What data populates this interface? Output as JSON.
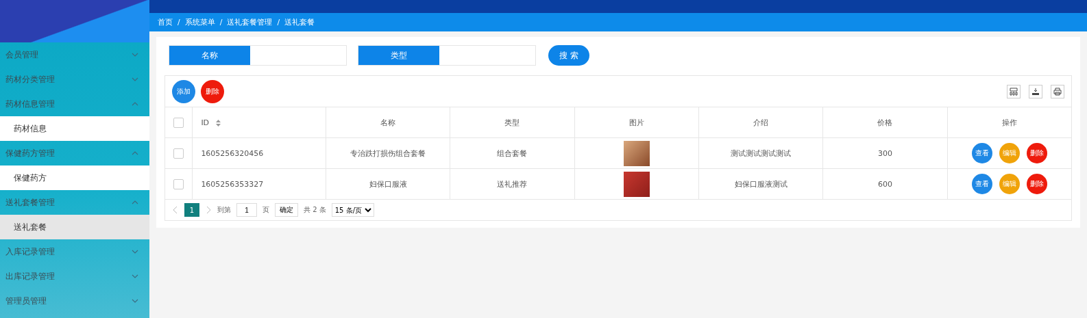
{
  "sidebar": {
    "items": [
      {
        "kind": "group",
        "label": "会员管理",
        "expanded": false
      },
      {
        "kind": "group",
        "label": "药材分类管理",
        "expanded": false
      },
      {
        "kind": "group",
        "label": "药材信息管理",
        "expanded": true
      },
      {
        "kind": "child",
        "label": "药材信息",
        "selected": false
      },
      {
        "kind": "group",
        "label": "保健药方管理",
        "expanded": true
      },
      {
        "kind": "child",
        "label": "保健药方",
        "selected": false
      },
      {
        "kind": "group",
        "label": "送礼套餐管理",
        "expanded": true
      },
      {
        "kind": "child",
        "label": "送礼套餐",
        "selected": true
      },
      {
        "kind": "group",
        "label": "入库记录管理",
        "expanded": false
      },
      {
        "kind": "group",
        "label": "出库记录管理",
        "expanded": false
      },
      {
        "kind": "group",
        "label": "管理员管理",
        "expanded": false
      }
    ]
  },
  "breadcrumb": [
    "首页",
    "系统菜单",
    "送礼套餐管理",
    "送礼套餐"
  ],
  "breadcrumb_separator": "/",
  "search": {
    "fields": [
      {
        "label": "名称"
      },
      {
        "label": "类型"
      }
    ],
    "button": "搜 索"
  },
  "toolbar": {
    "buttons": [
      {
        "label": "添加",
        "kind": "add"
      },
      {
        "label": "删除",
        "kind": "delete"
      }
    ]
  },
  "table": {
    "all_checked": false,
    "columns": [
      {
        "label": "ID",
        "sortable": true
      },
      {
        "label": "名称",
        "sortable": false
      },
      {
        "label": "类型",
        "sortable": false
      },
      {
        "label": "图片",
        "sortable": false
      },
      {
        "label": "介绍",
        "sortable": false
      },
      {
        "label": "价格",
        "sortable": false
      },
      {
        "label": "操作",
        "sortable": false
      }
    ],
    "rows": [
      {
        "checked": false,
        "id": "1605256320456",
        "name": "专治跌打损伤组合套餐",
        "type": "组合套餐",
        "intro": "测试测试测试测试",
        "price": "300",
        "actions": [
          {
            "label": "查看",
            "kind": "view"
          },
          {
            "label": "编辑",
            "kind": "edit"
          },
          {
            "label": "删除",
            "kind": "delete"
          }
        ]
      },
      {
        "checked": false,
        "id": "1605256353327",
        "name": "妇保口服液",
        "type": "送礼推荐",
        "intro": "妇保口服液测试",
        "price": "600",
        "actions": [
          {
            "label": "查看",
            "kind": "view"
          },
          {
            "label": "编辑",
            "kind": "edit"
          },
          {
            "label": "删除",
            "kind": "delete"
          }
        ]
      }
    ]
  },
  "pagination": {
    "pages": [
      {
        "label": "1",
        "selected": true
      }
    ],
    "goto_label": "到第",
    "page_input": "1",
    "page_unit": "页",
    "confirm": "确定",
    "total": "共 2 条",
    "page_size": "15 条/页"
  }
}
